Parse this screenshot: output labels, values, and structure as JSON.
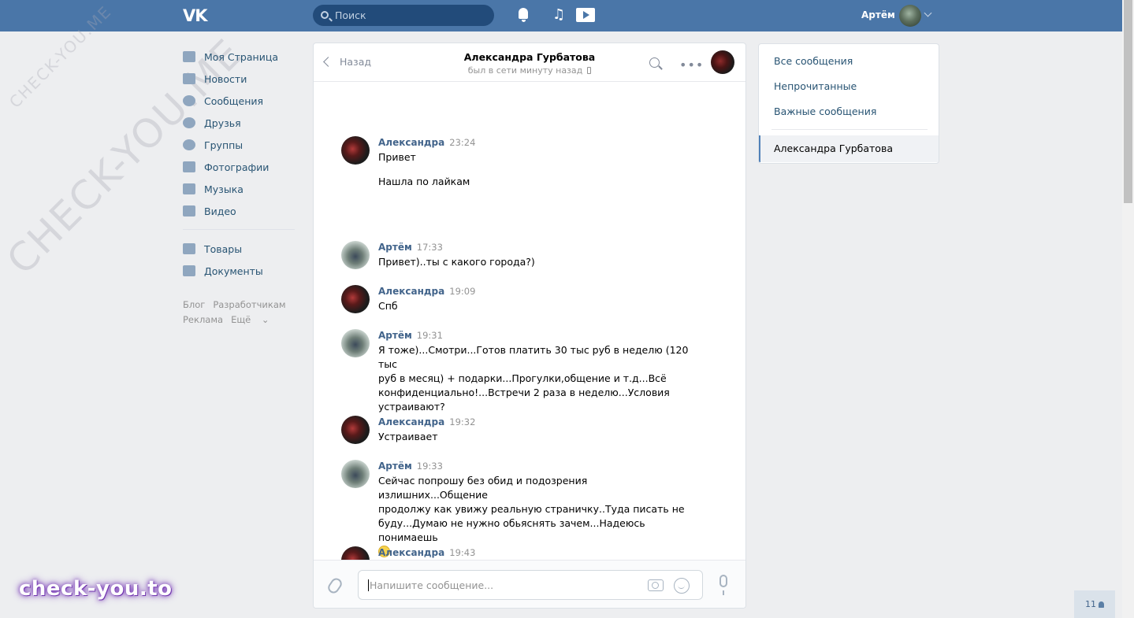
{
  "header": {
    "logo": "VK",
    "search_placeholder": "Поиск",
    "user_name": "Артём",
    "icons": [
      "bell-icon",
      "music-icon",
      "video-play-icon"
    ]
  },
  "nav": {
    "items": [
      {
        "label": "Моя Страница",
        "icon": "home-icon"
      },
      {
        "label": "Новости",
        "icon": "news-icon"
      },
      {
        "label": "Сообщения",
        "icon": "messages-icon"
      },
      {
        "label": "Друзья",
        "icon": "friends-icon"
      },
      {
        "label": "Группы",
        "icon": "groups-icon"
      },
      {
        "label": "Фотографии",
        "icon": "camera-icon"
      },
      {
        "label": "Музыка",
        "icon": "music-icon"
      },
      {
        "label": "Видео",
        "icon": "video-icon"
      }
    ],
    "items2": [
      {
        "label": "Товары",
        "icon": "bag-icon"
      },
      {
        "label": "Документы",
        "icon": "document-icon"
      }
    ],
    "footer": {
      "blog": "Блог",
      "dev": "Разработчикам",
      "ads": "Реклама",
      "more": "Ещё"
    }
  },
  "chat": {
    "back_label": "Назад",
    "peer_name": "Александра Гурбатова",
    "peer_status": "был в сети минуту назад",
    "messages": [
      {
        "author": "Александра",
        "time": "23:24",
        "lines": [
          "Привет",
          "",
          "Нашла по лайкам"
        ]
      },
      {
        "author": "Артём",
        "time": "17:33",
        "lines": [
          "Привет)..ты с какого города?)"
        ]
      },
      {
        "author": "Александра",
        "time": "19:09",
        "lines": [
          "Спб"
        ]
      },
      {
        "author": "Артём",
        "time": "19:31",
        "lines": [
          "Я тоже)...Смотри...Готов платить 30 тыс руб в неделю (120 тыс",
          "руб в месяц) + подарки...Прогулки,общение и т.д...Всё",
          "конфиденциально!...Встречи 2 раза в неделю...Условия",
          "устраивают?"
        ]
      },
      {
        "author": "Александра",
        "time": "19:32",
        "lines": [
          "Устраивает"
        ]
      },
      {
        "author": "Артём",
        "time": "19:33",
        "lines": [
          "Сейчас попрошу без обид и подозрения излишних...Общение",
          "продолжу как увижу реальную страничку..Туда писать не",
          "буду...Думаю не нужно обьяснять зачем...Надеюсь понимаешь"
        ]
      },
      {
        "author": "Александра",
        "time": "19:43",
        "lines": []
      }
    ],
    "input_placeholder": "Напишите сообщение..."
  },
  "side": {
    "all": "Все сообщения",
    "unread": "Непрочитанные",
    "important": "Важные сообщения",
    "active": "Александра Гурбатова"
  },
  "watermark": {
    "big": "CHECK-YOU.ME",
    "brand": "check-you.to"
  },
  "counter": "11",
  "colors": {
    "header": "#4a76a8",
    "link": "#285473",
    "author": "#42648b",
    "background": "#edeef0"
  }
}
